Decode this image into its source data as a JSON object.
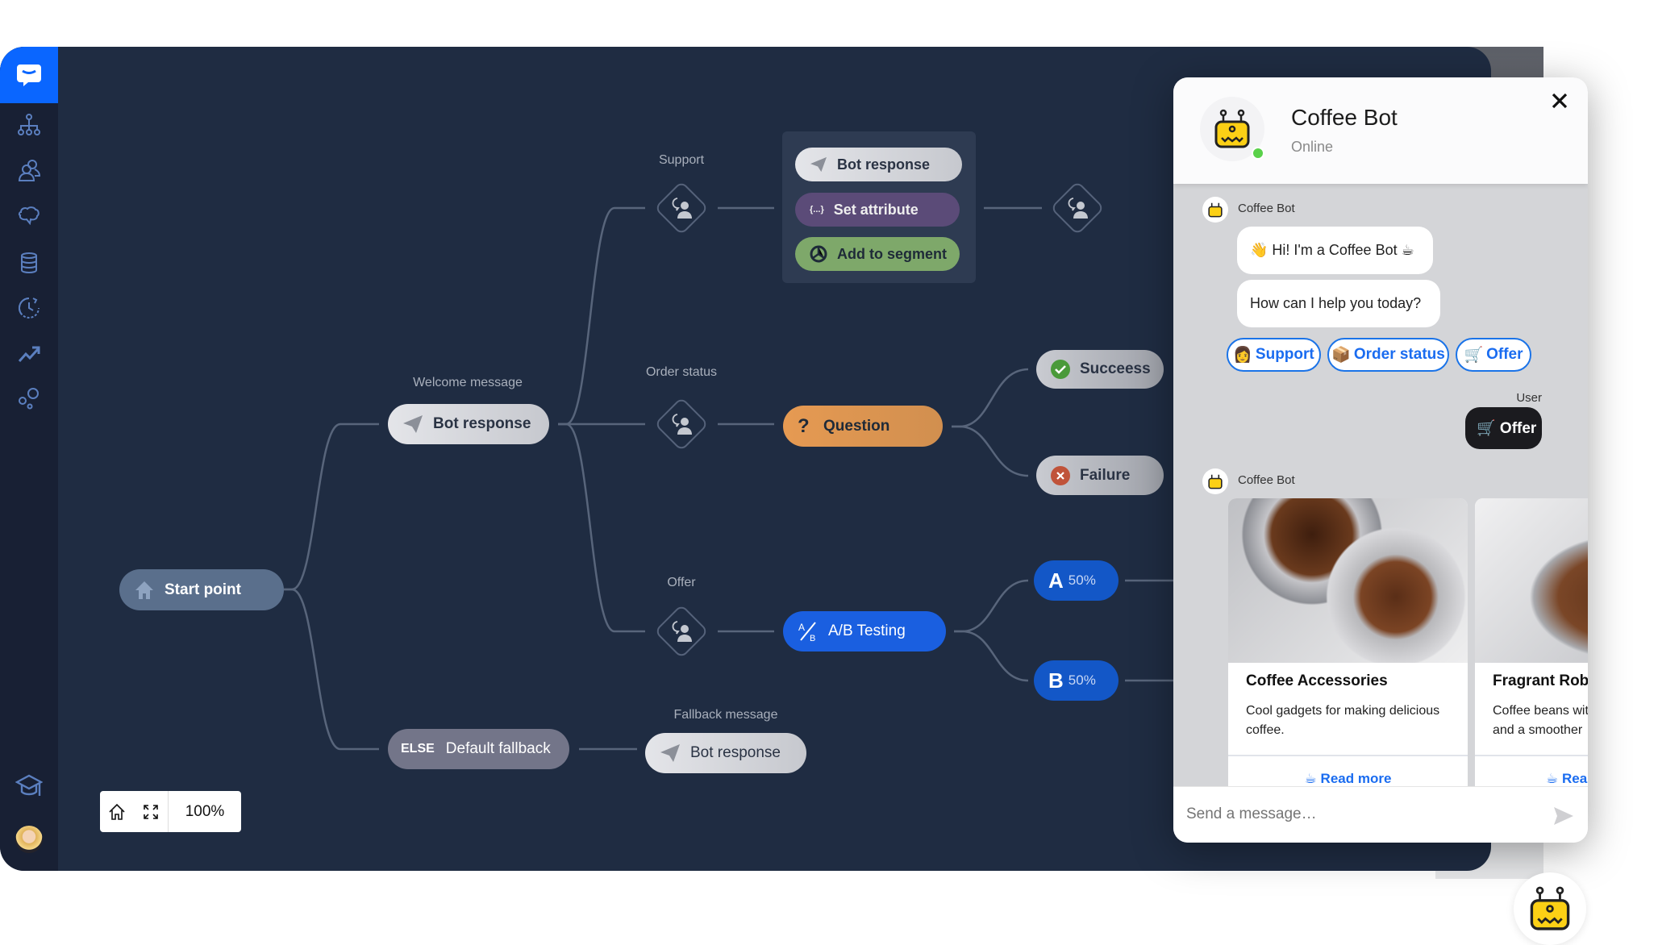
{
  "sidebar": {
    "items": [
      {
        "icon": "chat-logo-icon",
        "active": true
      },
      {
        "icon": "hierarchy-icon"
      },
      {
        "icon": "users-icon"
      },
      {
        "icon": "brain-icon"
      },
      {
        "icon": "database-icon"
      },
      {
        "icon": "clock-history-icon"
      },
      {
        "icon": "trending-up-icon"
      },
      {
        "icon": "bubbles-icon"
      },
      {
        "icon": "graduation-cap-icon"
      },
      {
        "icon": "user-avatar"
      }
    ]
  },
  "flow": {
    "start": "Start point",
    "welcome_label": "Welcome message",
    "welcome_node": "Bot response",
    "support_label": "Support",
    "group": {
      "bot_response": "Bot response",
      "set_attribute": "Set attribute",
      "set_attribute_icon": "{...}",
      "add_to_segment": "Add to segment"
    },
    "order_label": "Order status",
    "question": "Question",
    "question_icon": "?",
    "success": "Succeess",
    "failure": "Failure",
    "offer_label": "Offer",
    "ab_testing": "A/B Testing",
    "variant_a": {
      "letter": "A",
      "pct": "50%"
    },
    "variant_b": {
      "letter": "B",
      "pct": "50%"
    },
    "else_tag": "ELSE",
    "fallback": "Default fallback",
    "fallback_label": "Fallback message",
    "fallback_node": "Bot response"
  },
  "zoom": {
    "level": "100%"
  },
  "colors": {
    "canvas": "#1f2c42",
    "sidebar": "#182034",
    "accent": "#0a66ff",
    "question": "#e0954e",
    "set_attribute": "#5b4b78",
    "segment": "#7ea86a",
    "ab": "#1a5fe0",
    "online": "#5ad14a"
  },
  "chat": {
    "title": "Coffee Bot",
    "status": "Online",
    "sender": "Coffee Bot",
    "msg1": "👋 Hi! I'm a Coffee Bot ☕",
    "msg2": "How can I help you today?",
    "quick_replies": [
      {
        "emoji": "👩",
        "label": "Support"
      },
      {
        "emoji": "📦",
        "label": "Order status"
      },
      {
        "emoji": "🛒",
        "label": "Offer"
      }
    ],
    "user_label": "User",
    "user_msg": "🛒 Offer",
    "cards": [
      {
        "title": "Coffee Accessories",
        "desc": "Cool gadgets for making delicious coffee.",
        "button": "☕ Read more"
      },
      {
        "title": "Fragrant Robu",
        "desc": "Coffee beans wit and a smoother",
        "button": "☕ Rea"
      }
    ],
    "placeholder": "Send a message…"
  }
}
